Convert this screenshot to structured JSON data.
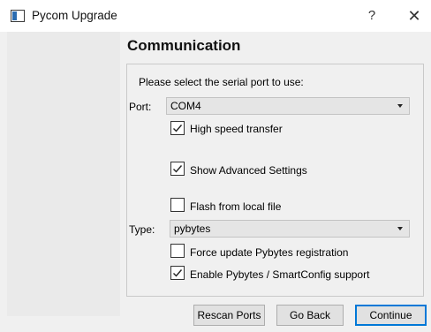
{
  "window": {
    "title": "Pycom Upgrade",
    "help_glyph": "?",
    "close_glyph": "✕"
  },
  "page": {
    "heading": "Communication",
    "prompt": "Please select the serial port to use:"
  },
  "port": {
    "label": "Port:",
    "value": "COM4"
  },
  "options": {
    "high_speed": {
      "label": "High speed transfer",
      "checked": true
    },
    "show_advanced": {
      "label": "Show Advanced Settings",
      "checked": true
    },
    "flash_local": {
      "label": "Flash from local file",
      "checked": false
    },
    "force_update": {
      "label": "Force update Pybytes registration",
      "checked": false
    },
    "enable_pybytes": {
      "label": "Enable Pybytes / SmartConfig support",
      "checked": true
    }
  },
  "type": {
    "label": "Type:",
    "value": "pybytes"
  },
  "buttons": {
    "rescan": "Rescan Ports",
    "go_back": "Go Back",
    "continue": "Continue"
  },
  "colors": {
    "accent": "#0078d7",
    "background": "#f0f0f0"
  }
}
